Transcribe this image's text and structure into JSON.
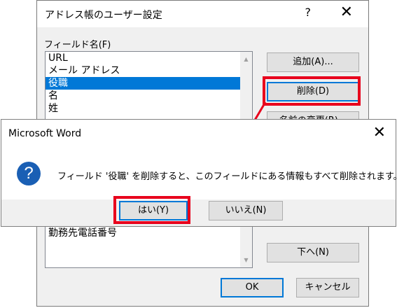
{
  "back_dialog": {
    "title": "アドレス帳のユーザー設定",
    "help": "?",
    "close": "✕",
    "field_label": "フィールド名(F)",
    "list_items": [
      "URL",
      "メール アドレス",
      "役職",
      "名",
      "姓"
    ],
    "list_item_lower": "勤務先電話番号",
    "selected_item": "役職",
    "buttons": {
      "add": "追加(A)...",
      "delete": "削除(D)",
      "rename": "名前の変更(R)...",
      "down": "下へ(N)",
      "ok": "OK",
      "cancel": "キャンセル"
    }
  },
  "message_box": {
    "title": "Microsoft Word",
    "close": "✕",
    "icon": "question-icon",
    "message": "フィールド '役職' を削除すると、このフィールドにある情報もすべて削除されます。",
    "yes": "はい(Y)",
    "no": "いいえ(N)"
  },
  "annotation_color": "#e8001c"
}
